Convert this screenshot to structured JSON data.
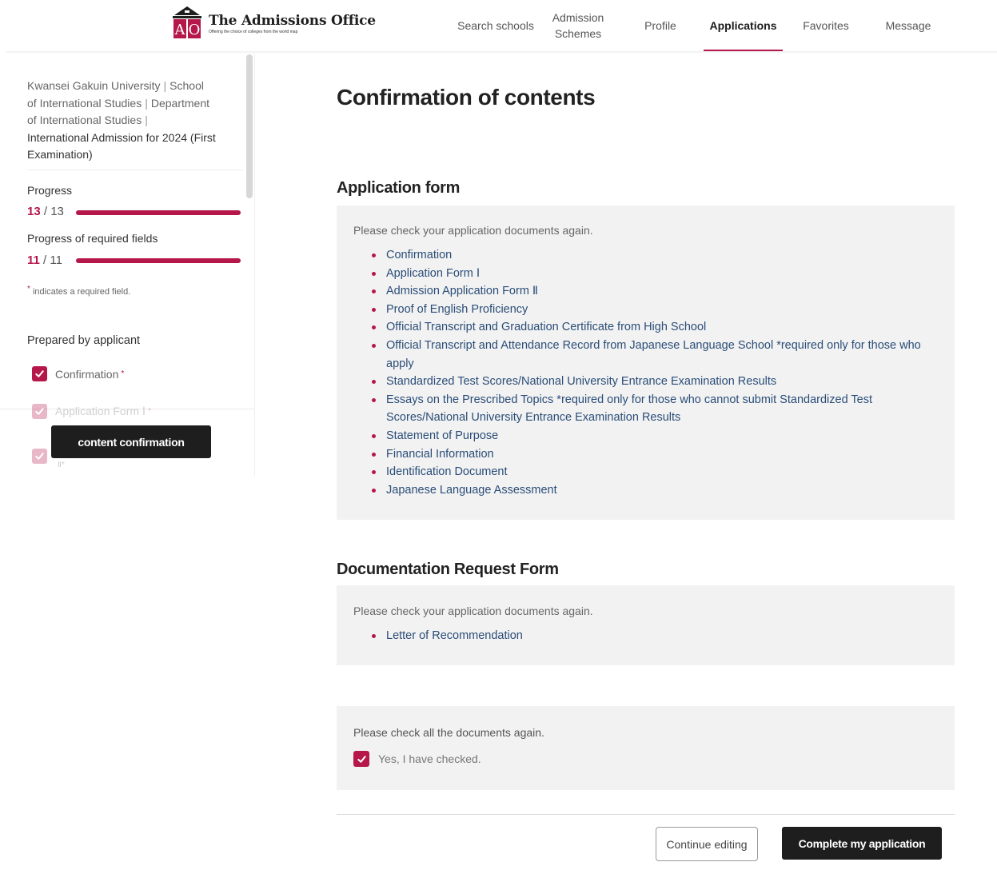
{
  "header": {
    "logo_title": "The Admissions Office",
    "logo_subtitle": "Offering the choice of colleges from the world map",
    "logo_letters": "AO",
    "nav": {
      "search": "Search schools",
      "schemes_line1": "Admission",
      "schemes_line2": "Schemes",
      "profile": "Profile",
      "applications": "Applications",
      "favorites": "Favorites",
      "message": "Message"
    },
    "active_nav": "Applications",
    "accent_color": "#b5174b"
  },
  "sidebar": {
    "university": "Kwansei Gakuin University",
    "school_line": "School",
    "school_line2": "of International Studies",
    "department": "Department",
    "department_line2": "of International Studies",
    "program": "International Admission for 2024 (First Examination)",
    "separator": "|",
    "progress": {
      "label": "Progress",
      "done": "13",
      "slash": " / ",
      "total": "13",
      "fraction": 1.0
    },
    "required_progress": {
      "label": "Progress of required fields",
      "done": "11",
      "slash": " / ",
      "total": "11",
      "fraction": 1.0
    },
    "required_note_mark": "*",
    "required_note": "indicates a required field.",
    "prepared_by": "Prepared by applicant",
    "items": [
      {
        "label": "Confirmation",
        "required": "*",
        "checked": true
      },
      {
        "label": "Application Form Ⅰ",
        "required": "*",
        "checked": true
      },
      {
        "label": "Ⅱ",
        "required": "*",
        "checked": true
      }
    ],
    "tooltip": "content confirmation"
  },
  "main": {
    "page_title": "Confirmation of contents",
    "application_form": {
      "title": "Application form",
      "intro": "Please check your application documents again.",
      "documents": [
        "Confirmation",
        "Application Form Ⅰ",
        "Admission Application Form Ⅱ",
        "Proof of English Proficiency",
        "Official Transcript and Graduation Certificate from High School",
        "Official Transcript and Attendance Record from Japanese Language School *required only for those who apply",
        "Standardized Test Scores/National University Entrance Examination Results",
        "Essays on the Prescribed Topics *required only for those who cannot submit Standardized Test Scores/National University Entrance Examination Results",
        "Statement of Purpose",
        "Financial Information",
        "Identification Document",
        "Japanese Language Assessment"
      ]
    },
    "documentation_request": {
      "title": "Documentation Request Form",
      "intro": "Please check your application documents again.",
      "documents": [
        "Letter of Recommendation"
      ]
    },
    "final_check": {
      "prompt": "Please check all the documents again.",
      "checkbox_label": "Yes, I have checked.",
      "checked": true
    },
    "buttons": {
      "continue_editing": "Continue editing",
      "complete": "Complete my application"
    }
  }
}
